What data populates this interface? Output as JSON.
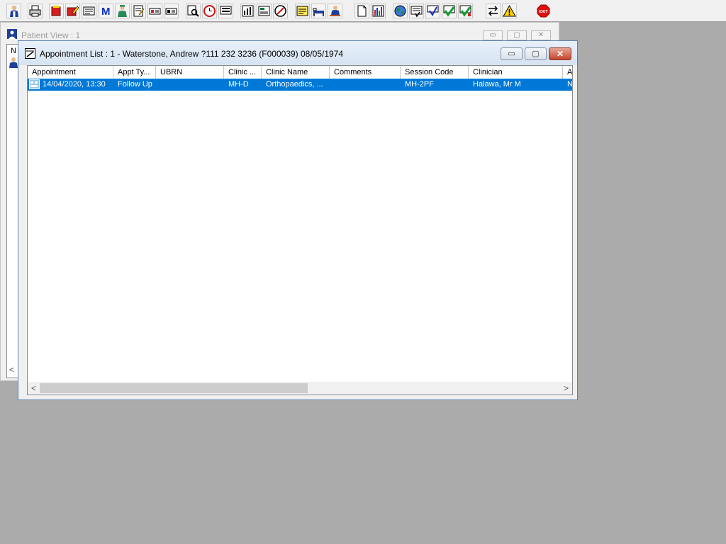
{
  "toolbar": {
    "buttons": [
      {
        "name": "user-doctor-icon"
      },
      {
        "name": "printer-icon"
      },
      {
        "name": "folder-red-icon"
      },
      {
        "name": "folder-edit-icon"
      },
      {
        "name": "card-icon"
      },
      {
        "name": "letter-m-icon"
      },
      {
        "name": "nurse-icon"
      },
      {
        "name": "notepad-icon"
      },
      {
        "name": "flag-icon"
      },
      {
        "name": "flag-alt-icon"
      },
      {
        "name": "search-document-icon"
      },
      {
        "name": "clock-icon"
      },
      {
        "name": "monitor-icon"
      },
      {
        "name": "chart-document-icon"
      },
      {
        "name": "form-icon"
      },
      {
        "name": "no-entry-icon"
      },
      {
        "name": "notes-icon"
      },
      {
        "name": "bed-icon"
      },
      {
        "name": "person-bed-icon"
      },
      {
        "name": "blank-page-icon"
      },
      {
        "name": "bar-chart-icon"
      },
      {
        "name": "globe-icon"
      },
      {
        "name": "checklist-icon"
      },
      {
        "name": "check-down-icon"
      },
      {
        "name": "green-check-icon"
      },
      {
        "name": "green-check-alt-icon"
      },
      {
        "name": "swap-arrows-icon"
      },
      {
        "name": "warning-icon"
      },
      {
        "name": "exit-icon",
        "label": "EXIT"
      }
    ]
  },
  "patient_view": {
    "title": "Patient View : 1",
    "column_stub": "N",
    "min_label": "▭",
    "max_label": "▢",
    "close_label": "✕"
  },
  "appointment_list": {
    "title": "Appointment List : 1 - Waterstone, Andrew ?111 232 3236 (F000039) 08/05/1974",
    "min_label": "▭",
    "max_label": "▢",
    "close_label": "✕",
    "columns": [
      "Appointment",
      "Appt Ty...",
      "UBRN",
      "Clinic ...",
      "Clinic Name",
      "Comments",
      "Session Code",
      "Clinician",
      "A"
    ],
    "rows": [
      {
        "appointment": "14/04/2020, 13:30",
        "appt_type": "Follow Up",
        "ubrn": "",
        "clinic_code": "MH-D",
        "clinic_name": "Orthopaedics, ...",
        "comments": "",
        "session_code": "MH-2PF",
        "clinician": "Halawa, Mr M",
        "a": "N"
      }
    ],
    "scroll_left": "<",
    "scroll_right": ">"
  },
  "colors": {
    "desktop": "#ababab",
    "selection": "#0078d7",
    "exit_red": "#e01010"
  }
}
